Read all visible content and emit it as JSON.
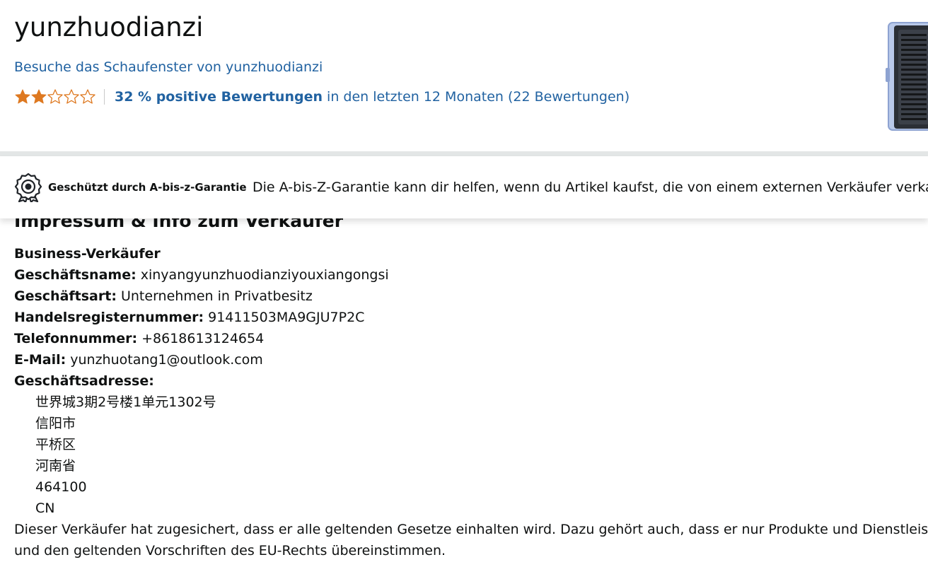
{
  "seller": {
    "name": "yunzhuodianzi",
    "storefront_link": "Besuche das Schaufenster von yunzhuodianzi"
  },
  "rating": {
    "stars_value": 2,
    "stars_max": 5,
    "positive_link": "32 % positive Bewertungen",
    "period_text": " in den letzten 12 Monaten (22 Bewertungen)"
  },
  "guarantee": {
    "title": "Geschützt durch A-bis-z-Garantie",
    "description": "Die A-bis-Z-Garantie kann dir helfen, wenn du Artikel kaufst, die von einem externen Verkäufer verkauft werden."
  },
  "impressum": {
    "heading": "Impressum & Info zum Verkäufer",
    "business_type_heading": "Business-Verkäufer",
    "fields": [
      {
        "label": "Geschäftsname:",
        "value": " xinyangyunzhuodianziyouxiangongsi"
      },
      {
        "label": "Geschäftsart:",
        "value": " Unternehmen in Privatbesitz"
      },
      {
        "label": "Handelsregisternummer:",
        "value": " 91411503MA9GJU7P2C"
      },
      {
        "label": "Telefonnummer:",
        "value": " +8618613124654"
      },
      {
        "label": "E-Mail:",
        "value": " yunzhuotang1@outlook.com"
      }
    ],
    "address_label": "Geschäftsadresse:",
    "address_lines": [
      "世界城3期2号楼1单元1302号",
      "信阳市",
      "平桥区",
      "河南省",
      "464100",
      "CN"
    ],
    "compliance_line1": "Dieser Verkäufer hat zugesichert, dass er alle geltenden Gesetze einhalten wird. Dazu gehört auch, dass er nur Produkte und Dienstleistungen anbietet, die den",
    "compliance_line2": "und den geltenden Vorschriften des EU-Rechts übereinstimmen."
  },
  "colors": {
    "link": "#2162a1",
    "star": "#de7921",
    "text": "#0f1111"
  },
  "icons": {
    "badge": "award-ribbon-icon",
    "star_filled": "star-filled-icon",
    "star_empty": "star-empty-icon"
  }
}
